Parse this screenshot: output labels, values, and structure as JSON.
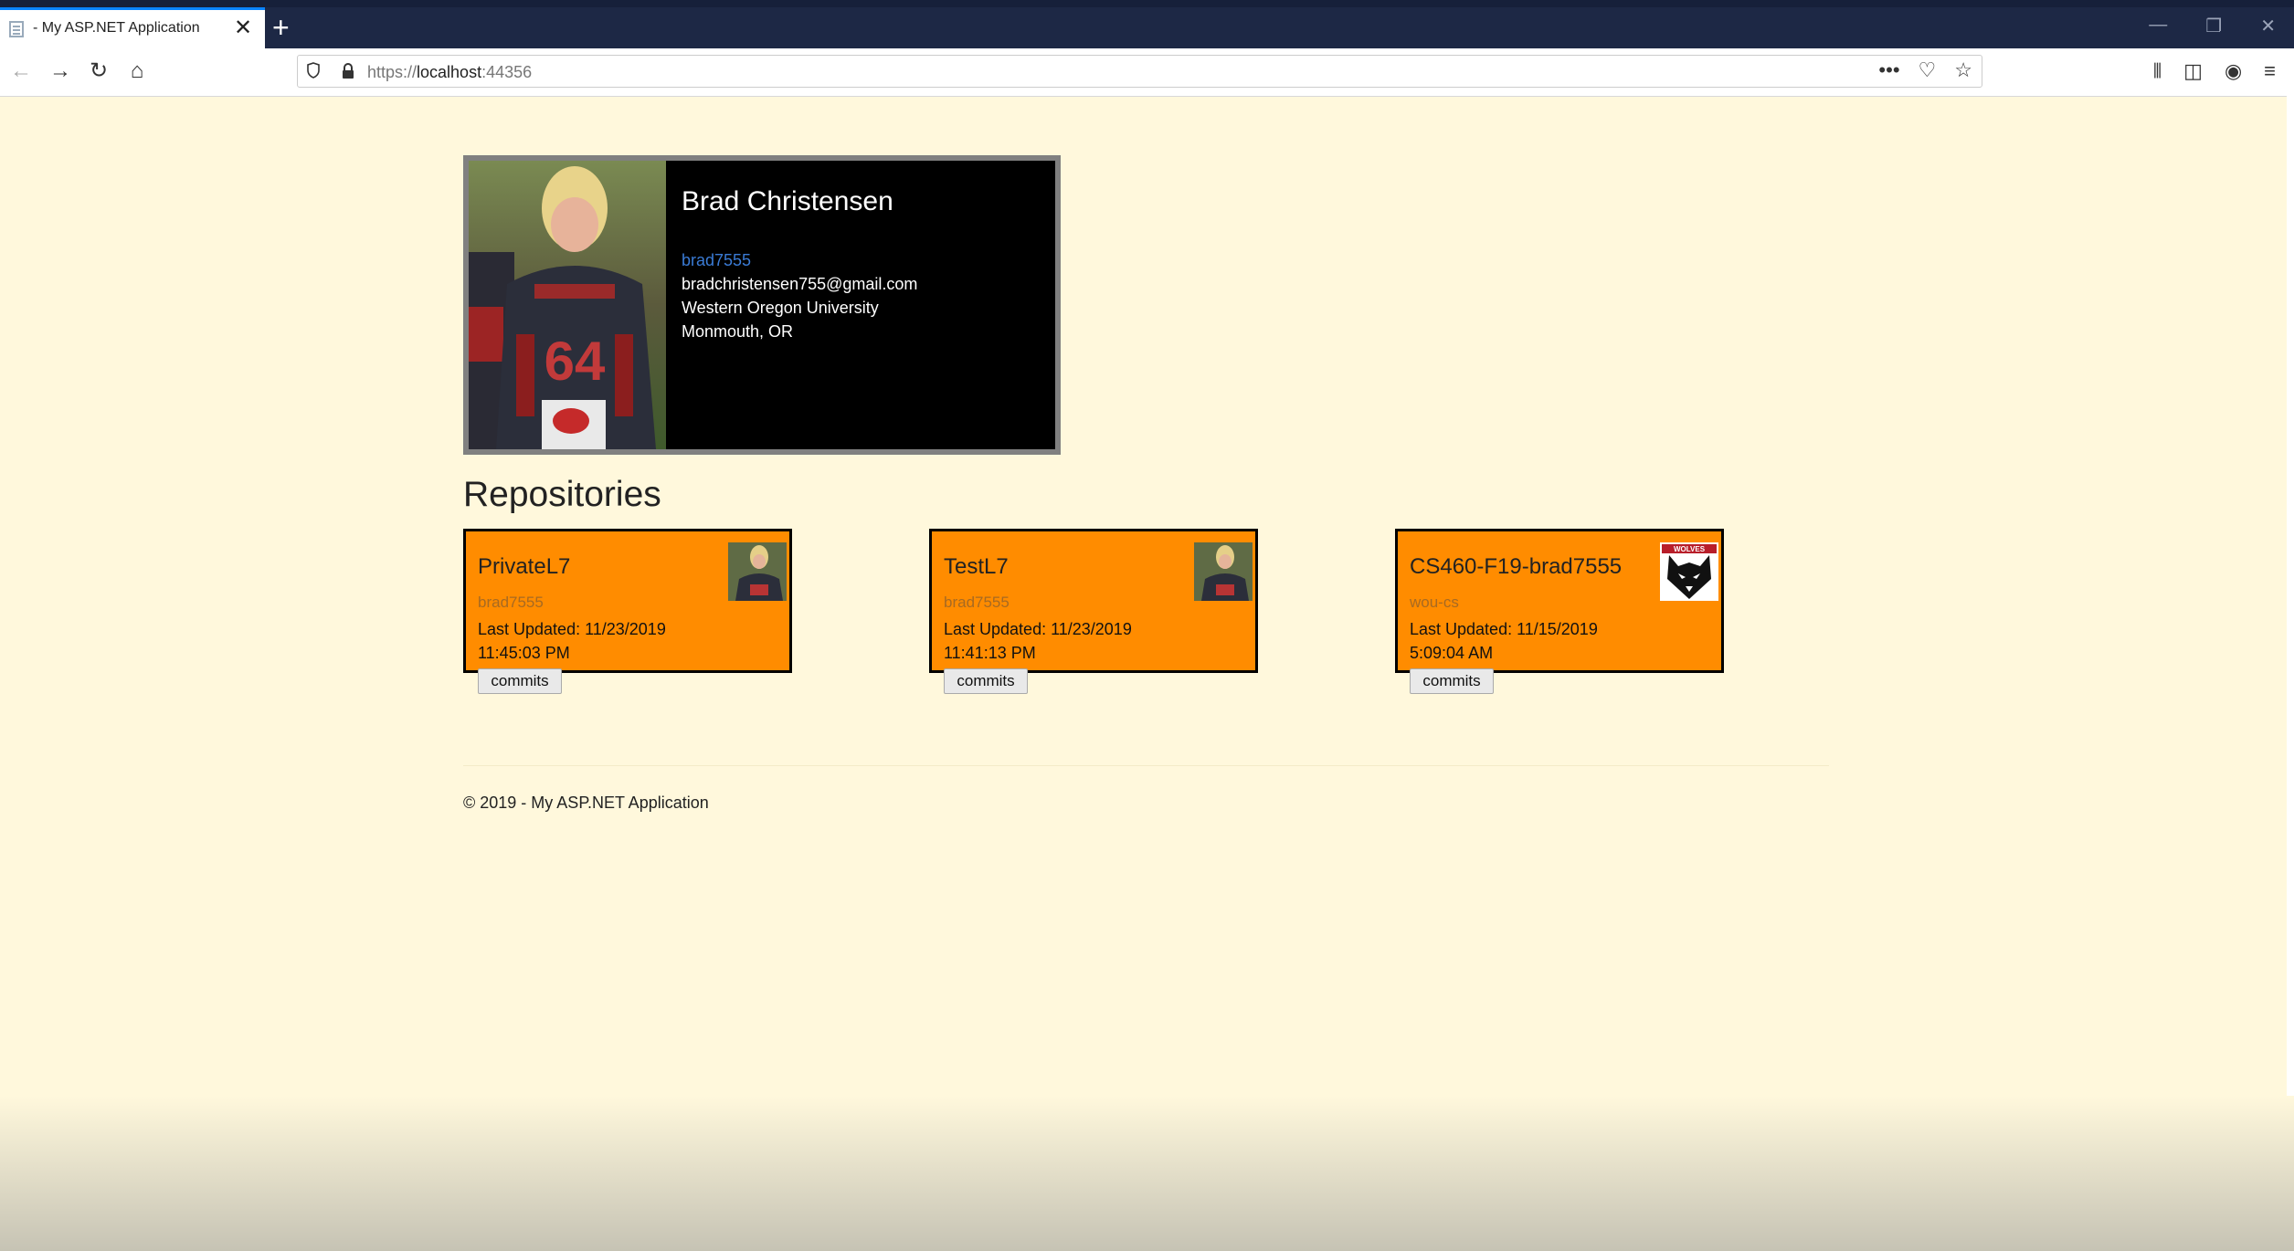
{
  "browser": {
    "tab_title": "- My ASP.NET Application",
    "url_host": "localhost",
    "url_prefix": "https://",
    "url_port": ":44356",
    "more_label": "•••"
  },
  "profile": {
    "name": "Brad Christensen",
    "login": "brad7555",
    "email": "bradchristensen755@gmail.com",
    "company": "Western Oregon University",
    "location": "Monmouth, OR",
    "jersey_number": "64"
  },
  "repositories_heading": "Repositories",
  "repositories": [
    {
      "name": "PrivateL7",
      "owner": "brad7555",
      "updated_date": "Last Updated: 11/23/2019",
      "updated_time": "11:45:03 PM",
      "button": "commits",
      "avatar": "player-photo"
    },
    {
      "name": "TestL7",
      "owner": "brad7555",
      "updated_date": "Last Updated: 11/23/2019",
      "updated_time": "11:41:13 PM",
      "button": "commits",
      "avatar": "player-photo"
    },
    {
      "name": "CS460-F19-brad7555",
      "owner": "wou-cs",
      "updated_date": "Last Updated: 11/15/2019",
      "updated_time": "5:09:04 AM",
      "button": "commits",
      "avatar": "wolves-logo",
      "logo_text": "WOLVES"
    }
  ],
  "footer": {
    "text": "© 2019 - My ASP.NET Application"
  },
  "colors": {
    "page_bg": "#fff8dc",
    "repo_card": "#ff8c00",
    "login_link": "#3a7bd5",
    "profile_card": "#000000"
  }
}
